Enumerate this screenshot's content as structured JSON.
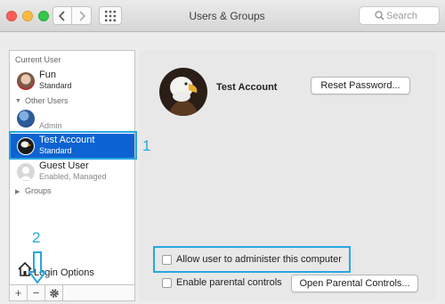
{
  "window": {
    "title": "Users & Groups"
  },
  "search": {
    "placeholder": "Search"
  },
  "sidebar": {
    "current_user_header": "Current User",
    "current_user": {
      "name": "Fun",
      "role": "Standard"
    },
    "other_users_header": "Other Users",
    "admin": {
      "role": "Admin"
    },
    "test_account": {
      "name": "Test Account",
      "role": "Standard"
    },
    "guest": {
      "name": "Guest User",
      "role": "Enabled, Managed"
    },
    "groups_label": "Groups",
    "login_options": "Login Options",
    "add_icon": "+",
    "remove_icon": "−",
    "gear_icon": "gear-icon"
  },
  "main": {
    "account_name": "Test Account",
    "reset_password": "Reset Password...",
    "allow_admin": "Allow user to administer this computer",
    "parental_controls": "Enable parental controls",
    "open_parental": "Open Parental Controls..."
  },
  "annotations": {
    "callout_1": "1",
    "callout_2": "2"
  },
  "colors": {
    "selection": "#0d63d1",
    "callout": "#28a7e2"
  }
}
